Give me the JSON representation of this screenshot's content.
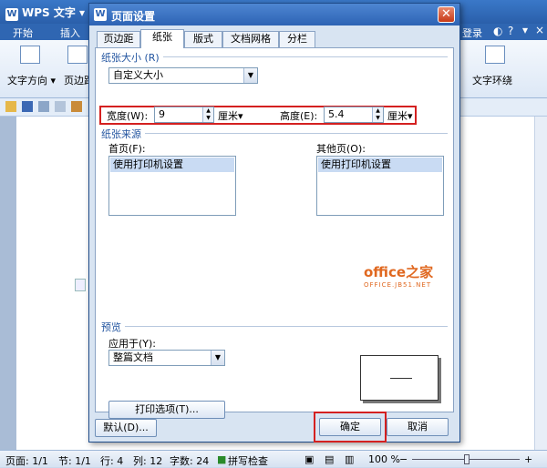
{
  "app": {
    "title": "WPS 文字",
    "tabs": [
      "开始",
      "插入"
    ],
    "right_bar": {
      "login": "登录"
    },
    "ribbon": {
      "text_direction": "文字方向 ▾",
      "margins": "页边距",
      "text_wrap": "文字环绕"
    }
  },
  "status_bar": {
    "page": "页面: 1/1",
    "section": "节: 1/1",
    "row": "行: 4",
    "col": "列: 12",
    "chars": "字数: 24",
    "spell": "拼写检查",
    "zoom": "100 %",
    "minus": "−",
    "plus": "+"
  },
  "dialog": {
    "title": "页面设置",
    "close_glyph": "✕",
    "tabs": [
      {
        "label": "页边距",
        "active": false
      },
      {
        "label": "纸张",
        "active": true
      },
      {
        "label": "版式",
        "active": false
      },
      {
        "label": "文档网格",
        "active": false
      },
      {
        "label": "分栏",
        "active": false
      }
    ],
    "paper_size": {
      "group_title": "纸张大小 (R)",
      "selected": "自定义大小",
      "width_label": "宽度(W):",
      "width_value": "9",
      "width_unit": "厘米▾",
      "height_label": "高度(E):",
      "height_value": "5.4",
      "height_unit": "厘米▾"
    },
    "paper_source": {
      "group_title": "纸张来源",
      "first_page_label": "首页(F):",
      "first_page_value": "使用打印机设置",
      "other_pages_label": "其他页(O):",
      "other_pages_value": "使用打印机设置"
    },
    "preview": {
      "group_title": "预览",
      "apply_to_label": "应用于(Y):",
      "apply_to_value": "整篇文档",
      "print_options": "打印选项(T)..."
    },
    "watermark": {
      "main": "office之家",
      "sub": "OFFICE.JB51.NET"
    },
    "buttons": {
      "default": "默认(D)...",
      "ok": "确定",
      "cancel": "取消"
    },
    "colors": {
      "highlight": "#d42020",
      "title_bar": "#2d63b4"
    }
  }
}
